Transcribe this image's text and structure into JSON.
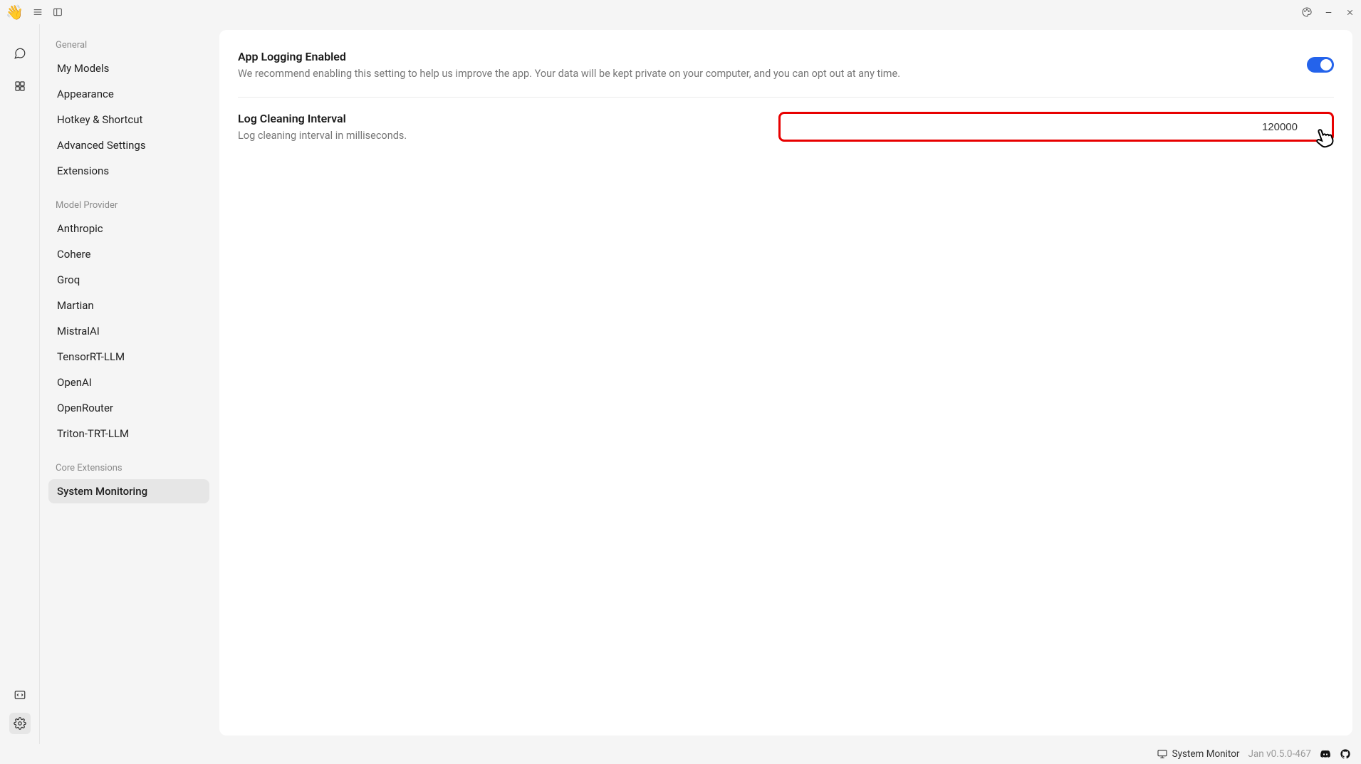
{
  "titlebar": {
    "wave": "👋"
  },
  "sidebar": {
    "groups": [
      {
        "title": "General",
        "items": [
          "My Models",
          "Appearance",
          "Hotkey & Shortcut",
          "Advanced Settings",
          "Extensions"
        ]
      },
      {
        "title": "Model Provider",
        "items": [
          "Anthropic",
          "Cohere",
          "Groq",
          "Martian",
          "MistralAI",
          "TensorRT-LLM",
          "OpenAI",
          "OpenRouter",
          "Triton-TRT-LLM"
        ]
      },
      {
        "title": "Core Extensions",
        "items": [
          "System Monitoring"
        ]
      }
    ],
    "active": "System Monitoring"
  },
  "settings": {
    "logging": {
      "title": "App Logging Enabled",
      "desc": "We recommend enabling this setting to help us improve the app. Your data will be kept private on your computer, and you can opt out at any time.",
      "enabled": true
    },
    "interval": {
      "title": "Log Cleaning Interval",
      "desc": "Log cleaning interval in milliseconds.",
      "value": "120000"
    }
  },
  "statusbar": {
    "monitor": "System Monitor",
    "version": "Jan v0.5.0-467"
  }
}
